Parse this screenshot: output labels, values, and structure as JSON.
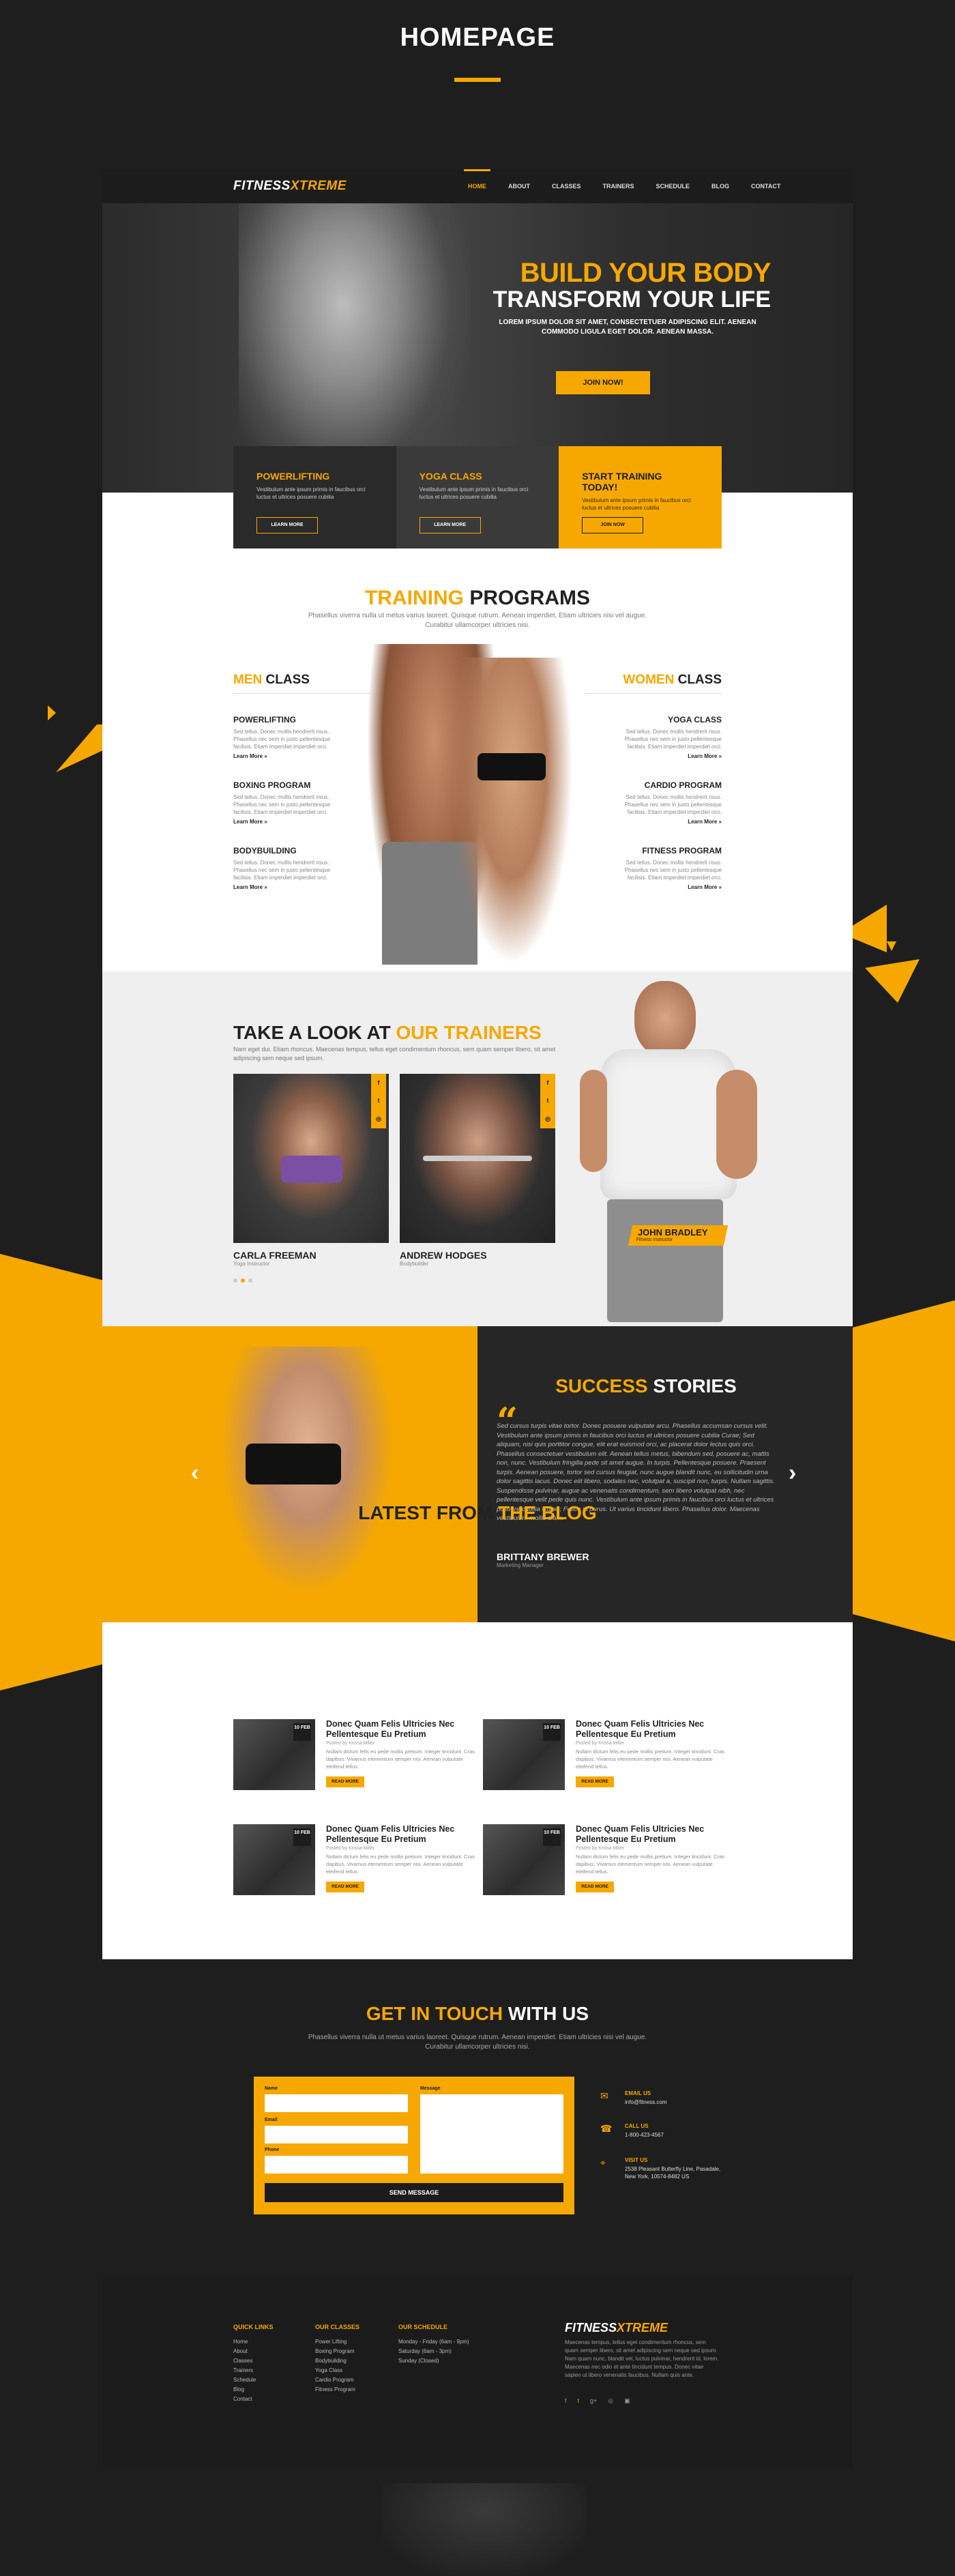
{
  "page_title": "HOMEPAGE",
  "brand": {
    "logo_a": "FITNESS",
    "logo_b": "XTREME",
    "accent": "#f6a800",
    "dark": "#1c1c1c"
  },
  "nav": {
    "items": [
      "HOME",
      "ABOUT",
      "CLASSES",
      "TRAINERS",
      "SCHEDULE",
      "BLOG",
      "CONTACT"
    ],
    "active": "HOME"
  },
  "hero": {
    "title": "BUILD YOUR BODY",
    "subtitle": "TRANSFORM YOUR LIFE",
    "text": "LOREM IPSUM DOLOR SIT AMET, CONSECTETUER ADIPISCING ELIT. AENEAN COMMODO LIGULA EGET DOLOR. AENEAN MASSA.",
    "cta": "JOIN NOW!"
  },
  "promos": [
    {
      "title": "POWERLIFTING",
      "text": "Vestibulum ante ipsum primis in faucibus orci luctus et ultrices posuere cubilia",
      "button": "LEARN MORE"
    },
    {
      "title": "YOGA CLASS",
      "text": "Vestibulum ante ipsum primis in faucibus orci luctus et ultrices posuere cubilia",
      "button": "LEARN MORE"
    },
    {
      "title": "START TRAINING TODAY!",
      "text": "Vestibulum ante ipsum primis in faucibus orci luctus et ultrices posuere cubilia",
      "button": "JOIN NOW"
    }
  ],
  "training": {
    "title_a": "TRAINING",
    "title_b": "PROGRAMS",
    "subtitle": "Phasellus viverra nulla ut metus varius laoreet. Quisque rutrum. Aenean imperdiet. Etiam ultricies nisi vel augue. Curabitur ullamcorper ultricies nisi.",
    "men_a": "MEN",
    "men_b": "CLASS",
    "women_a": "WOMEN",
    "women_b": "CLASS",
    "men_items": [
      {
        "title": "POWERLIFTING",
        "text": "Sed tellus. Donec mollis hendrerit risus. Phasellus nec sem in justo pellentesque facilisis. Etiam imperdiet imperdiet orci.",
        "more": "Learn More »"
      },
      {
        "title": "BOXING PROGRAM",
        "text": "Sed tellus. Donec mollis hendrerit risus. Phasellus nec sem in justo pellentesque facilisis. Etiam imperdiet imperdiet orci.",
        "more": "Learn More »"
      },
      {
        "title": "BODYBUILDING",
        "text": "Sed tellus. Donec mollis hendrerit risus. Phasellus nec sem in justo pellentesque facilisis. Etiam imperdiet imperdiet orci.",
        "more": "Learn More »"
      }
    ],
    "women_items": [
      {
        "title": "YOGA CLASS",
        "text": "Sed tellus. Donec mollis hendrerit risus. Phasellus nec sem in justo pellentesque facilisis. Etiam imperdiet imperdiet orci.",
        "more": "Learn More »"
      },
      {
        "title": "CARDIO PROGRAM",
        "text": "Sed tellus. Donec mollis hendrerit risus. Phasellus nec sem in justo pellentesque facilisis. Etiam imperdiet imperdiet orci.",
        "more": "Learn More »"
      },
      {
        "title": "FITNESS PROGRAM",
        "text": "Sed tellus. Donec mollis hendrerit risus. Phasellus nec sem in justo pellentesque facilisis. Etiam imperdiet imperdiet orci.",
        "more": "Learn More »"
      }
    ]
  },
  "trainers": {
    "title_a": "TAKE A LOOK AT",
    "title_b": "OUR TRAINERS",
    "subtitle": "Nam eget dui. Etiam rhoncus. Maecenas tempus, tellus eget condimentum rhoncus, sem quam semper libero, sit amet adipiscing sem neque sed ipsum.",
    "people": [
      {
        "name": "CARLA FREEMAN",
        "role": "Yoga Instructor"
      },
      {
        "name": "ANDREW HODGES",
        "role": "Bodybuilder"
      }
    ],
    "featured": {
      "name": "JOHN BRADLEY",
      "role": "Fitness Instructor"
    },
    "social": [
      "f",
      "t",
      "◎"
    ]
  },
  "success": {
    "title_a": "SUCCESS",
    "title_b": "STORIES",
    "text": "Sed cursus turpis vitae tortor. Donec posuere vulputate arcu. Phasellus accumsan cursus velit. Vestibulum ante ipsum primis in faucibus orci luctus et ultrices posuere cubilia Curae; Sed aliquam, nisi quis porttitor congue, elit erat euismod orci, ac placerat dolor lectus quis orci. Phasellus consectetuer vestibulum elit. Aenean tellus metus, bibendum sed, posuere ac, mattis non, nunc. Vestibulum fringilla pede sit amet augue. In turpis. Pellentesque posuere. Praesent turpis. Aenean posuere, tortor sed cursus feugiat, nunc augue blandit nunc, eu sollicitudin urna dolor sagittis lacus. Donec elit libero, sodales nec, volutpat a, suscipit non, turpis. Nullam sagittis. Suspendisse pulvinar, augue ac venenatis condimentum, sem libero volutpat nibh, nec pellentesque velit pede quis nunc. Vestibulum ante ipsum primis in faucibus orci luctus et ultrices posuere cubilia Curae; Fusce id purus. Ut varius tincidunt libero. Phasellus dolor. Maecenas vestibulum mollis diam.",
    "name": "BRITTANY BREWER",
    "role": "Marketing Manager"
  },
  "blog": {
    "title_a": "LATEST FROM",
    "title_b": "THE BLOG",
    "posts": [
      {
        "date": "10 FEB",
        "title": "Donec Quam Felis Ultricies Nec Pellentesque Eu Pretium",
        "by": "Posted by Krissa Miller",
        "text": "Nullam dictum felis eu pede mollis pretium. Integer tincidunt. Cras dapibus. Vivamus elementum semper nisi. Aenean vulputate eleifend tellus.",
        "more": "READ MORE"
      },
      {
        "date": "10 FEB",
        "title": "Donec Quam Felis Ultricies Nec Pellentesque Eu Pretium",
        "by": "Posted by Krissa Miller",
        "text": "Nullam dictum felis eu pede mollis pretium. Integer tincidunt. Cras dapibus. Vivamus elementum semper nisi. Aenean vulputate eleifend tellus.",
        "more": "READ MORE"
      },
      {
        "date": "10 FEB",
        "title": "Donec Quam Felis Ultricies Nec Pellentesque Eu Pretium",
        "by": "Posted by Krissa Miller",
        "text": "Nullam dictum felis eu pede mollis pretium. Integer tincidunt. Cras dapibus. Vivamus elementum semper nisi. Aenean vulputate eleifend tellus.",
        "more": "READ MORE"
      },
      {
        "date": "10 FEB",
        "title": "Donec Quam Felis Ultricies Nec Pellentesque Eu Pretium",
        "by": "Posted by Krissa Miller",
        "text": "Nullam dictum felis eu pede mollis pretium. Integer tincidunt. Cras dapibus. Vivamus elementum semper nisi. Aenean vulputate eleifend tellus.",
        "more": "READ MORE"
      }
    ]
  },
  "contact": {
    "title_a": "GET IN TOUCH",
    "title_b": "WITH US",
    "subtitle": "Phasellus viverra nulla ut metus varius laoreet. Quisque rutrum. Aenean imperdiet. Etiam ultricies nisi vel augue. Curabitur ullamcorper ultricies nisi.",
    "labels": {
      "name": "Name",
      "email": "Email",
      "phone": "Phone",
      "message": "Message"
    },
    "send": "SEND MESSAGE",
    "info": [
      {
        "icon": "envelope-icon",
        "glyph": "✉",
        "label": "EMAIL US",
        "value": "info@fitness.com"
      },
      {
        "icon": "phone-icon",
        "glyph": "☎",
        "label": "CALL US",
        "value": "1-800-423-4567"
      },
      {
        "icon": "location-icon",
        "glyph": "⌖",
        "label": "VISIT US",
        "value": "2538 Pleasant Butterfly Line, Pasadale, New York, 10574-8482 US"
      }
    ]
  },
  "footer": {
    "quick_links": {
      "title": "QUICK LINKS",
      "items": [
        "Home",
        "About",
        "Classes",
        "Trainers",
        "Schedule",
        "Blog",
        "Contact"
      ]
    },
    "classes": {
      "title": "OUR CLASSES",
      "items": [
        "Power Lifting",
        "Boxing Program",
        "Bodybuilding",
        "Yoga Class",
        "Cardio Program",
        "Fitness Program"
      ]
    },
    "schedule": {
      "title": "OUR SCHEDULE",
      "items": [
        "Monday - Friday (6am - 9pm)",
        "Saturday (6am - 3pm)",
        "Sunday (Closed)"
      ]
    },
    "about": "Maecenas tempus, tellus eget condimentum rhoncus, sem quam semper libero, sit amet adipiscing sem neque sed ipsum. Nam quam nunc, blandit vel, luctus pulvinar, hendrerit id, lorem. Maecenas nec odio et ante tincidunt tempus. Donec vitae sapien ut libero venenatis faucibus. Nullam quis ante.",
    "social": [
      "f",
      "t",
      "g+",
      "◎",
      "▣"
    ]
  }
}
